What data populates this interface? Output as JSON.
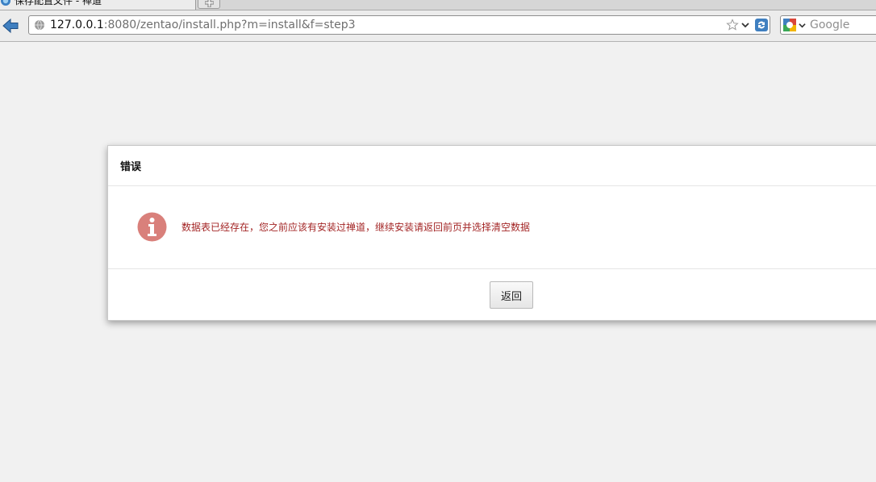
{
  "browser": {
    "tab_title": "保存配置文件 - 禅道",
    "url_host": "127.0.0.1",
    "url_rest": ":8080/zentao/install.php?m=install&f=step3",
    "search_placeholder": "Google"
  },
  "dialog": {
    "title": "错误",
    "message": "数据表已经存在，您之前应该有安装过禅道，继续安装请返回前页并选择清空数据",
    "back_button_label": "返回"
  },
  "colors": {
    "message": "#a32525",
    "info_icon": "#d9807b",
    "page_background": "#f1f1f1"
  },
  "icons": {
    "back": "arrow-left-icon",
    "site": "globe-icon",
    "bookmark": "star-icon",
    "reload": "reload-icon",
    "search_engine": "google-icon",
    "info": "info-icon",
    "new_tab": "plus-icon"
  }
}
